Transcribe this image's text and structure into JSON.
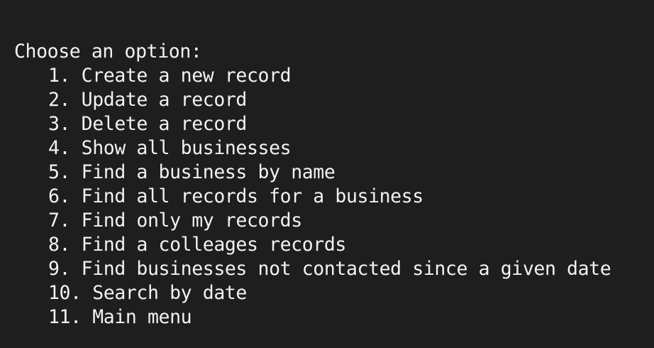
{
  "terminal": {
    "prompt": "Choose an option:",
    "options": [
      "1. Create a new record",
      "2. Update a record",
      "3. Delete a record",
      "4. Show all businesses",
      "5. Find a business by name",
      "6. Find all records for a business",
      "7. Find only my records",
      "8. Find a colleages records",
      "9. Find businesses not contacted since a given date",
      "10. Search by date",
      "11. Main menu"
    ],
    "colors": {
      "background": "#1e1e1e",
      "text": "#f2f2f2"
    }
  }
}
